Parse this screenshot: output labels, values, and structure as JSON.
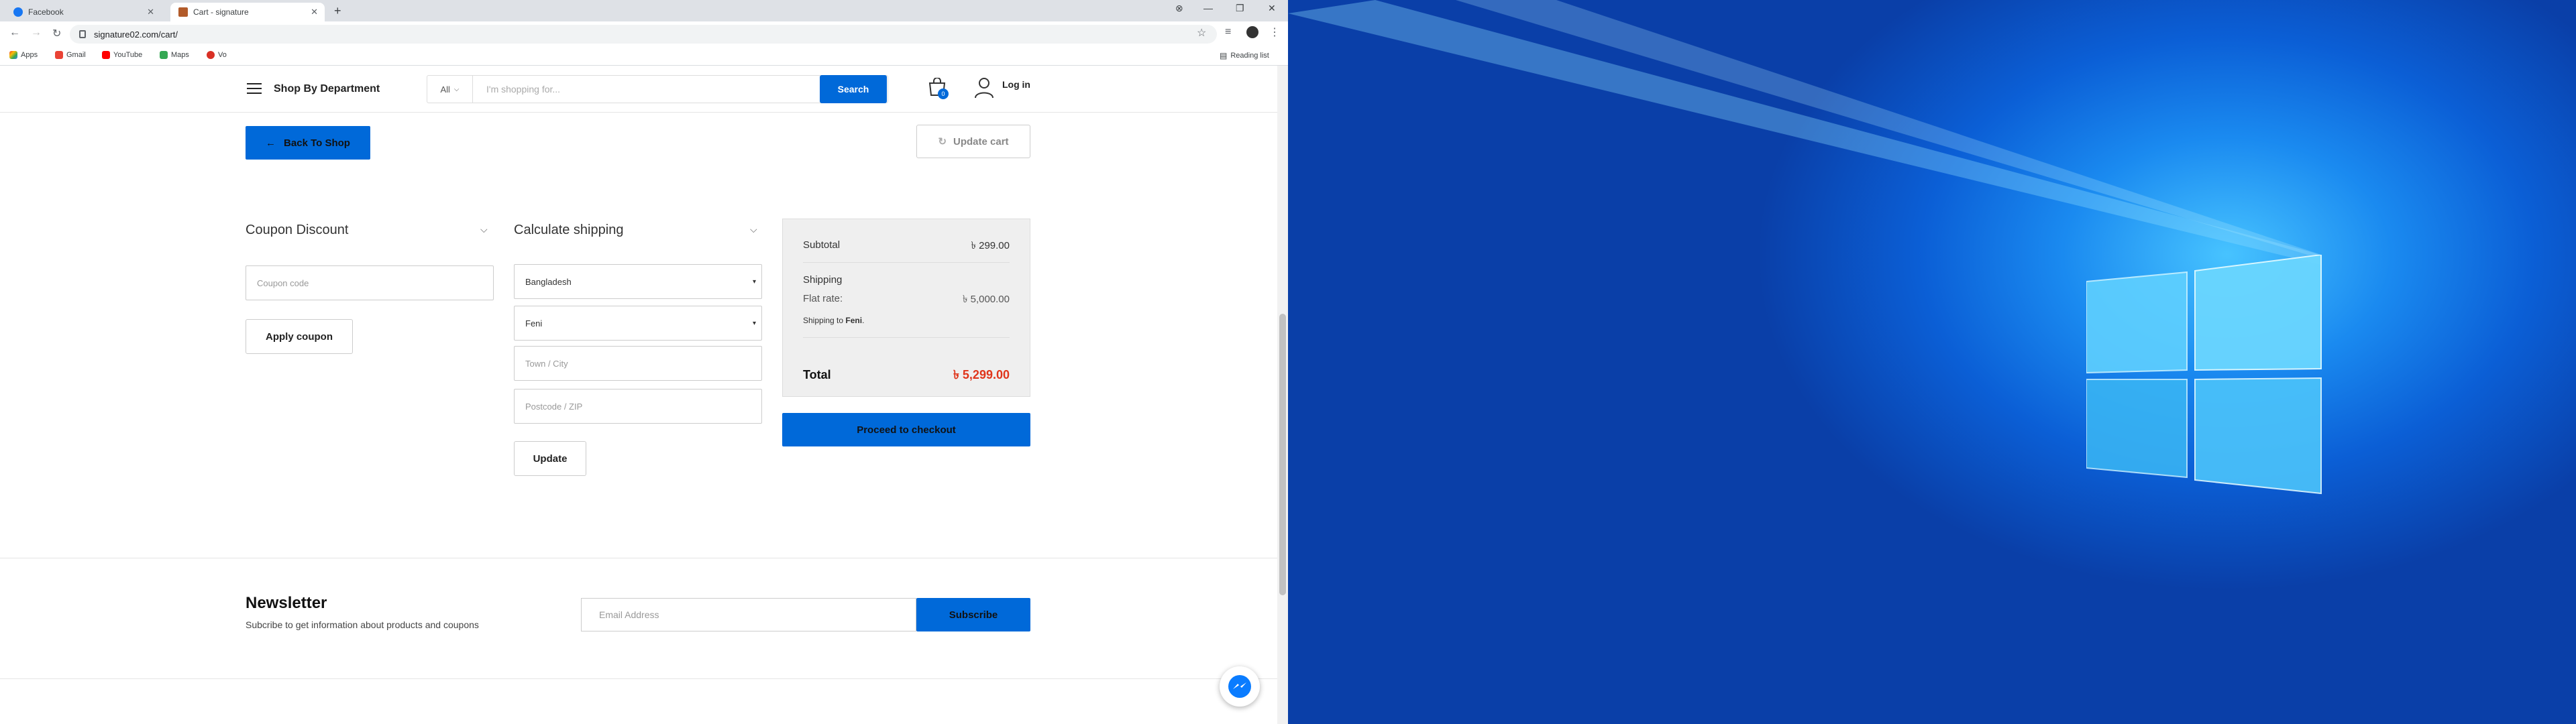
{
  "browser": {
    "tabs": [
      {
        "title": "Facebook",
        "icon": "facebook-icon",
        "active": false
      },
      {
        "title": "Cart - signature",
        "icon": "site-favicon",
        "active": true
      }
    ],
    "url": "signature02.com/cart/",
    "bookmarks": [
      {
        "label": "Apps",
        "icon": "apps-grid-icon"
      },
      {
        "label": "Gmail",
        "icon": "gmail-icon"
      },
      {
        "label": "YouTube",
        "icon": "youtube-icon"
      },
      {
        "label": "Maps",
        "icon": "maps-icon"
      },
      {
        "label": "Vo",
        "icon": "vo-icon"
      }
    ],
    "reading_list": "Reading list"
  },
  "header": {
    "department_label": "Shop By Department",
    "search_category": "All",
    "search_placeholder": "I'm shopping for...",
    "search_button": "Search",
    "cart_count": "0",
    "login_label": "Log in"
  },
  "cart_actions": {
    "back_label": "Back To Shop",
    "update_cart_label": "Update cart"
  },
  "coupon": {
    "title": "Coupon Discount",
    "placeholder": "Coupon code",
    "apply_label": "Apply coupon"
  },
  "shipping_calc": {
    "title": "Calculate shipping",
    "country": "Bangladesh",
    "district": "Feni",
    "city_placeholder": "Town / City",
    "postcode_placeholder": "Postcode / ZIP",
    "update_label": "Update"
  },
  "totals": {
    "subtotal_label": "Subtotal",
    "subtotal_value": "৳ 299.00",
    "shipping_label": "Shipping",
    "flat_rate_label": "Flat rate:",
    "flat_rate_value": "৳ 5,000.00",
    "shipping_to_prefix": "Shipping to",
    "shipping_to_place": "Feni",
    "total_label": "Total",
    "total_value": "৳ 5,299.00",
    "proceed_label": "Proceed to checkout"
  },
  "newsletter": {
    "title": "Newsletter",
    "subtitle": "Subcribe to get information about products and coupons",
    "email_placeholder": "Email Address",
    "subscribe_label": "Subscribe"
  },
  "colors": {
    "primary": "#0069d9",
    "total_red": "#e0351b"
  }
}
